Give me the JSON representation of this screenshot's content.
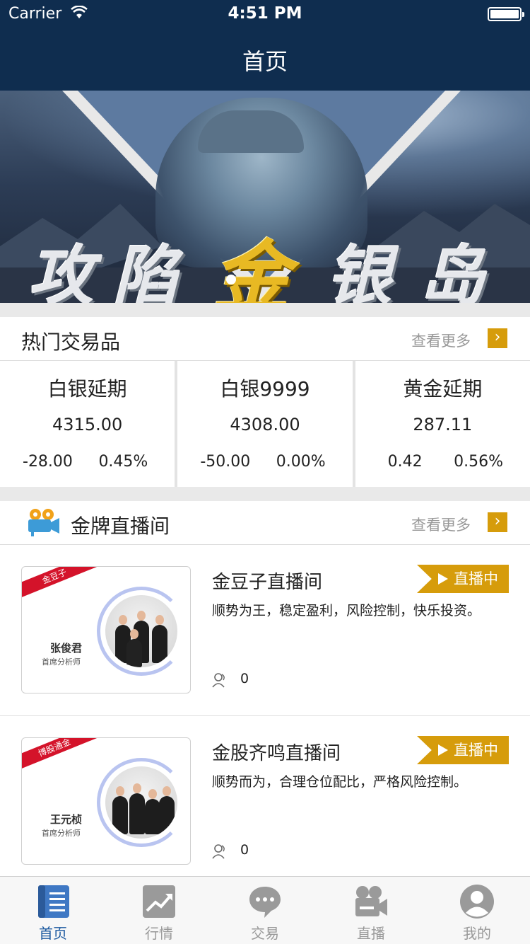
{
  "status_bar": {
    "carrier": "Carrier",
    "time": "4:51 PM"
  },
  "nav": {
    "title": "首页"
  },
  "banner": {
    "slogan_chars": [
      "攻",
      "陷",
      "金",
      "银",
      "岛"
    ],
    "slide_count": 2,
    "active_slide": 1
  },
  "hot_products": {
    "title": "热门交易品",
    "more_label": "查看更多",
    "items": [
      {
        "name": "白银延期",
        "price": "4315.00",
        "change": "-28.00",
        "percent": "0.45%"
      },
      {
        "name": "白银9999",
        "price": "4308.00",
        "change": "-50.00",
        "percent": "0.00%"
      },
      {
        "name": "黄金延期",
        "price": "287.11",
        "change": "0.42",
        "percent": "0.56%"
      }
    ]
  },
  "live_rooms": {
    "title": "金牌直播间",
    "more_label": "查看更多",
    "rooms": [
      {
        "title": "金豆子直播间",
        "description": "顺势为王，稳定盈利，风险控制，快乐投资。",
        "status": "直播中",
        "viewers": "0",
        "ribbon": "金豆子",
        "analyst_name": "张俊君",
        "analyst_role": "首席分析师"
      },
      {
        "title": "金股齐鸣直播间",
        "description": "顺势而为，合理仓位配比，严格风险控制。",
        "status": "直播中",
        "viewers": "0",
        "ribbon": "博股通金",
        "analyst_name": "王元桢",
        "analyst_role": "首席分析师"
      }
    ]
  },
  "tabbar": {
    "tabs": [
      {
        "label": "首页",
        "icon": "home-icon",
        "active": true
      },
      {
        "label": "行情",
        "icon": "market-chart-icon",
        "active": false
      },
      {
        "label": "交易",
        "icon": "chat-bubble-icon",
        "active": false
      },
      {
        "label": "直播",
        "icon": "video-camera-icon",
        "active": false
      },
      {
        "label": "我的",
        "icon": "profile-icon",
        "active": false
      }
    ]
  },
  "colors": {
    "navbar": "#0f2d4f",
    "accent_gold": "#d69c0b",
    "tab_active": "#1d5aa0",
    "ribbon_red": "#d4132a"
  }
}
